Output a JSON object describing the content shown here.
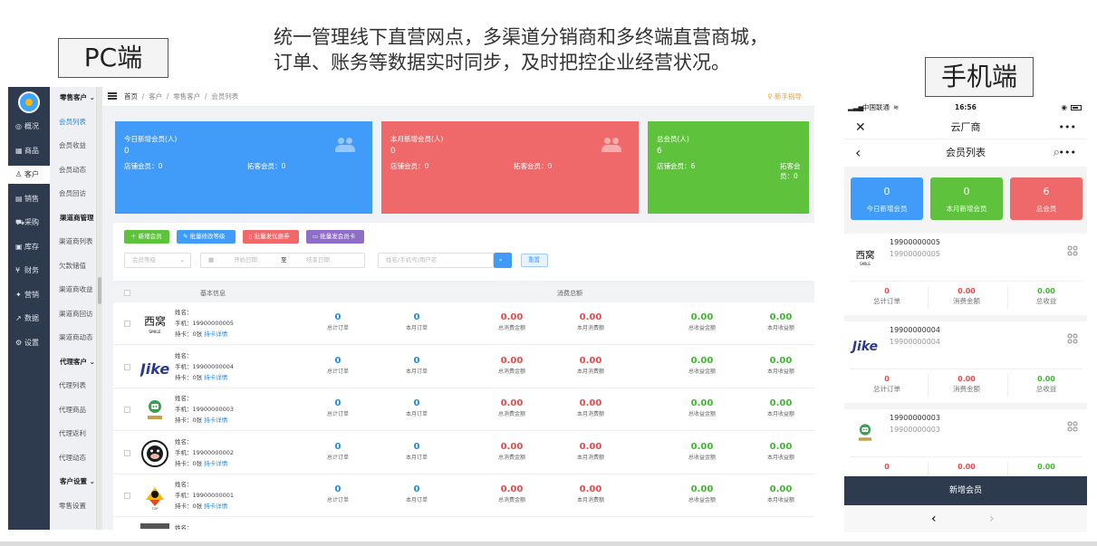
{
  "headline": {
    "line1": "统一管理线下直营网点，多渠道分销商和多终端直营商城，",
    "line2": "订单、账务等数据实时同步，及时把控企业经营状况。"
  },
  "labels": {
    "pc": "PC端",
    "mobile": "手机端"
  },
  "pc": {
    "main_nav": [
      {
        "icon": "chart-icon",
        "glyph": "◎",
        "label": "概况"
      },
      {
        "icon": "grid-icon",
        "glyph": "▦",
        "label": "商品"
      },
      {
        "icon": "user-icon",
        "glyph": "♙",
        "label": "客户"
      },
      {
        "icon": "doc-icon",
        "glyph": "▤",
        "label": "销售"
      },
      {
        "icon": "cart-icon",
        "glyph": "⛟",
        "label": "采购"
      },
      {
        "icon": "box-icon",
        "glyph": "▣",
        "label": "库存"
      },
      {
        "icon": "money-icon",
        "glyph": "¥",
        "label": "财务"
      },
      {
        "icon": "gift-icon",
        "glyph": "✦",
        "label": "营销"
      },
      {
        "icon": "data-icon",
        "glyph": "↗",
        "label": "数据"
      },
      {
        "icon": "gear-icon",
        "glyph": "⚙",
        "label": "设置"
      }
    ],
    "sub_nav": [
      {
        "label": "零售客户",
        "group": true
      },
      {
        "label": "会员列表",
        "active": true
      },
      {
        "label": "会员收益"
      },
      {
        "label": "会员动态"
      },
      {
        "label": "会员回访"
      },
      {
        "label": "渠道商管理",
        "group": true
      },
      {
        "label": "渠道商列表"
      },
      {
        "label": "欠款储值"
      },
      {
        "label": "渠道商收益"
      },
      {
        "label": "渠道商回访"
      },
      {
        "label": "渠道商动态"
      },
      {
        "label": "代理客户",
        "group": true
      },
      {
        "label": "代理列表"
      },
      {
        "label": "代理商品"
      },
      {
        "label": "代理返利"
      },
      {
        "label": "代理动态"
      },
      {
        "label": "客户设置",
        "group": true
      },
      {
        "label": "零售设置"
      }
    ],
    "breadcrumb": {
      "home": "首页",
      "sep": "/",
      "c1": "客户",
      "c2": "零售客户",
      "c3": "会员列表"
    },
    "guide": "新手指导",
    "stats": [
      {
        "title": "今日新增会员(人)",
        "value": "0",
        "shop": "店铺会员：0",
        "expand": "拓客会员：0",
        "color": "#419bf9"
      },
      {
        "title": "本月新增会员(人)",
        "value": "0",
        "shop": "店铺会员：0",
        "expand": "拓客会员：0",
        "color": "#f0696a"
      },
      {
        "title": "总会员(人)",
        "value": "6",
        "shop": "店铺会员：6",
        "expand": "拓客会员：0",
        "color": "#5fc23d"
      }
    ],
    "buttons": [
      {
        "label": "＋ 新增会员",
        "color": "#5fc23d"
      },
      {
        "label": "✎ 批量修改等级",
        "color": "#419bf9"
      },
      {
        "label": "▯ 批量发优惠券",
        "color": "#f0696a"
      },
      {
        "label": "▭ 批量发会员卡",
        "color": "#8f6ec9"
      }
    ],
    "filters": {
      "level_placeholder": "会员等级",
      "start_placeholder": "开始日期",
      "to": "至",
      "end_placeholder": "结束日期",
      "search_placeholder": "姓名/手机号/用户名",
      "reset": "重置"
    },
    "table_head": {
      "basic": "基本信息",
      "consume": "消费总额"
    },
    "metric_labels": [
      "总计订单",
      "本月订单",
      "总消费金额",
      "本月消费额",
      "总收益金额",
      "本月收益额"
    ],
    "rows": [
      {
        "logo": "xiwo",
        "name": "姓名：",
        "phone": "手机：19900000005",
        "card": "持卡：0张",
        "detail": "持卡详情",
        "values": [
          "0",
          "0",
          "0.00",
          "0.00",
          "0.00",
          "0.00"
        ]
      },
      {
        "logo": "jike",
        "name": "姓名：",
        "phone": "手机：19900000004",
        "card": "持卡：0张",
        "detail": "持卡详情",
        "values": [
          "0",
          "0",
          "0.00",
          "0.00",
          "0.00",
          "0.00"
        ]
      },
      {
        "logo": "coffee",
        "name": "姓名：",
        "phone": "手机：19900000003",
        "card": "持卡：0张",
        "detail": "持卡详情",
        "values": [
          "0",
          "0",
          "0.00",
          "0.00",
          "0.00",
          "0.00"
        ]
      },
      {
        "logo": "cow",
        "name": "姓名：",
        "phone": "手机：19900000002",
        "card": "持卡：0张",
        "detail": "持卡详情",
        "values": [
          "0",
          "0",
          "0.00",
          "0.00",
          "0.00",
          "0.00"
        ]
      },
      {
        "logo": "bird",
        "name": "姓名：",
        "phone": "手机：19900000001",
        "card": "持卡：0张",
        "detail": "持卡详情",
        "values": [
          "0",
          "0",
          "0.00",
          "0.00",
          "0.00",
          "0.00"
        ]
      }
    ],
    "partial_row_name": "姓名："
  },
  "mobile": {
    "status": {
      "carrier": "中国联通",
      "time": "16:56"
    },
    "nav_title": "云厂商",
    "page_title": "会员列表",
    "cards": [
      {
        "value": "0",
        "label": "今日新增会员",
        "color": "#419bf9"
      },
      {
        "value": "0",
        "label": "本月新增会员",
        "color": "#5fc23d"
      },
      {
        "value": "6",
        "label": "总会员",
        "color": "#f0696a"
      }
    ],
    "stat_labels": [
      "总计订单",
      "消费金额",
      "总收益"
    ],
    "rows": [
      {
        "logo": "xiwo",
        "phone": "19900000005",
        "phone2": "19900000005",
        "values": [
          "0",
          "0.00",
          "0.00"
        ]
      },
      {
        "logo": "jike",
        "phone": "19900000004",
        "phone2": "19900000004",
        "values": [
          "0",
          "0.00",
          "0.00"
        ]
      },
      {
        "logo": "coffee",
        "phone": "19900000003",
        "phone2": "19900000003",
        "values": [
          "0",
          "0.00",
          "0.00"
        ]
      }
    ],
    "footer_button": "新增会员"
  }
}
